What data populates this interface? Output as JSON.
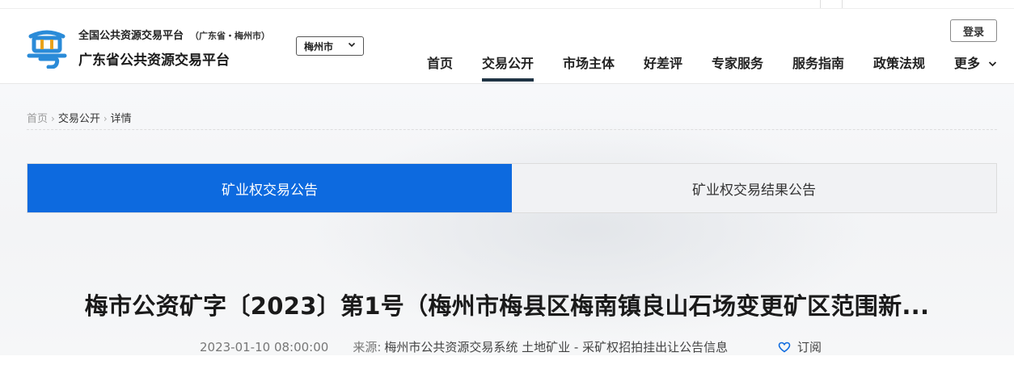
{
  "header": {
    "platform_title": "全国公共资源交易平台",
    "platform_sub": "（广东省・梅州市）",
    "site_name": "广东省公共资源交易平台",
    "city": "梅州市",
    "login": "登录",
    "nav": [
      "首页",
      "交易公开",
      "市场主体",
      "好差评",
      "专家服务",
      "服务指南",
      "政策法规",
      "更多"
    ],
    "active_nav": "交易公开",
    "brand_color": "#0d6adf",
    "logo_icon": "yue-character-logo-icon"
  },
  "breadcrumb": [
    "首页",
    "交易公开",
    "详情"
  ],
  "tabs": [
    {
      "label": "矿业权交易公告",
      "active": true
    },
    {
      "label": "矿业权交易结果公告",
      "active": false
    }
  ],
  "article": {
    "title": "梅市公资矿字〔2023〕第1号（梅州市梅县区梅南镇良山石场变更矿区范围新...",
    "date": "2023-01-10 08:00:00",
    "source_label": "来源:",
    "source": "梅州市公共资源交易系统 土地矿业 - 采矿权招拍挂出让公告信息",
    "subscribe": "订阅"
  }
}
